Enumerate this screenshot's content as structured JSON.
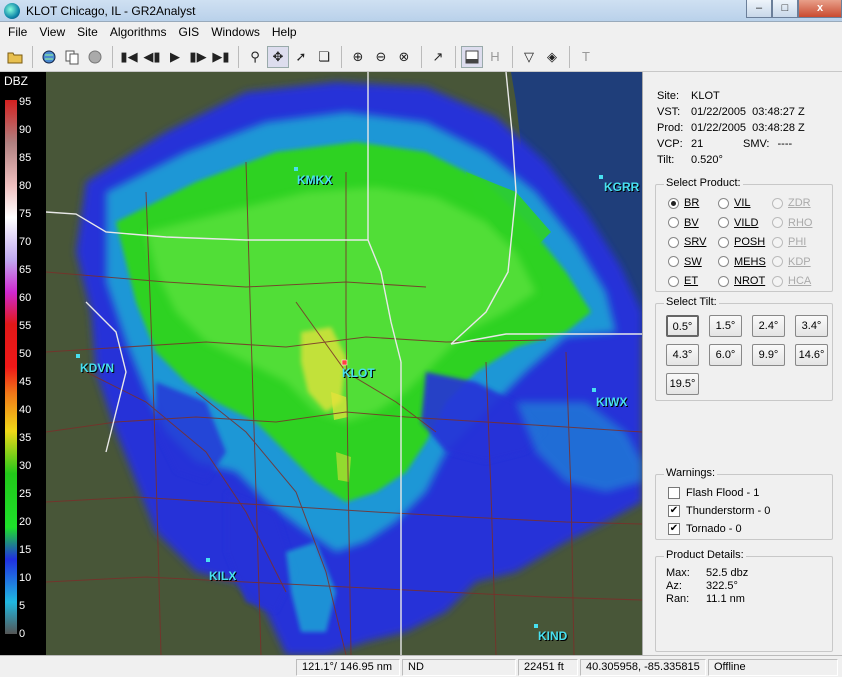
{
  "window": {
    "title": "KLOT Chicago, IL - GR2Analyst",
    "minimize_label": "–",
    "maximize_label": "□",
    "close_label": "x"
  },
  "menu": [
    "File",
    "View",
    "Site",
    "Algorithms",
    "GIS",
    "Windows",
    "Help"
  ],
  "scale": {
    "title": "DBZ",
    "labels": [
      "95",
      "90",
      "85",
      "80",
      "75",
      "70",
      "65",
      "60",
      "55",
      "50",
      "45",
      "40",
      "35",
      "30",
      "25",
      "20",
      "15",
      "10",
      "5",
      "0"
    ]
  },
  "map": {
    "sites": [
      {
        "id": "KMKX",
        "label": "KMKX"
      },
      {
        "id": "KGRR",
        "label": "KGRR"
      },
      {
        "id": "KDVN",
        "label": "KDVN"
      },
      {
        "id": "KLOT",
        "label": "KLOT"
      },
      {
        "id": "KIWX",
        "label": "KIWX"
      },
      {
        "id": "KILX",
        "label": "KILX"
      },
      {
        "id": "KIND",
        "label": "KIND"
      }
    ]
  },
  "site_info": {
    "site_label": "Site:",
    "site": "KLOT",
    "vst_label": "VST:",
    "vst": "01/22/2005  03:48:27 Z",
    "prod_label": "Prod:",
    "prod": "01/22/2005  03:48:28 Z",
    "vcp_label": "VCP:",
    "vcp": "21",
    "smv_label": "SMV:",
    "smv": "----",
    "tilt_label": "Tilt:",
    "tilt": "0.520°"
  },
  "select_product": {
    "title": "Select Product:",
    "col1": [
      {
        "label": "BR",
        "selected": true,
        "enabled": true
      },
      {
        "label": "BV",
        "selected": false,
        "enabled": true
      },
      {
        "label": "SRV",
        "selected": false,
        "enabled": true
      },
      {
        "label": "SW",
        "selected": false,
        "enabled": true
      },
      {
        "label": "ET",
        "selected": false,
        "enabled": true
      }
    ],
    "col2": [
      {
        "label": "VIL",
        "selected": false,
        "enabled": true
      },
      {
        "label": "VILD",
        "selected": false,
        "enabled": true
      },
      {
        "label": "POSH",
        "selected": false,
        "enabled": true
      },
      {
        "label": "MEHS",
        "selected": false,
        "enabled": true
      },
      {
        "label": "NROT",
        "selected": false,
        "enabled": true
      }
    ],
    "col3": [
      {
        "label": "ZDR",
        "selected": false,
        "enabled": false
      },
      {
        "label": "RHO",
        "selected": false,
        "enabled": false
      },
      {
        "label": "PHI",
        "selected": false,
        "enabled": false
      },
      {
        "label": "KDP",
        "selected": false,
        "enabled": false
      },
      {
        "label": "HCA",
        "selected": false,
        "enabled": false
      }
    ]
  },
  "select_tilt": {
    "title": "Select Tilt:",
    "tilts": [
      "0.5°",
      "1.5°",
      "2.4°",
      "3.4°",
      "4.3°",
      "6.0°",
      "9.9°",
      "14.6°",
      "19.5°"
    ],
    "active": 0
  },
  "warnings": {
    "title": "Warnings:",
    "items": [
      {
        "label": "Flash Flood - 1",
        "checked": false
      },
      {
        "label": "Thunderstorm - 0",
        "checked": true
      },
      {
        "label": "Tornado - 0",
        "checked": true
      }
    ]
  },
  "product_details": {
    "title": "Product Details:",
    "max_label": "Max:",
    "max": "52.5 dbz",
    "az_label": "Az:",
    "az": "322.5°",
    "ran_label": "Ran:",
    "ran": "11.1 nm"
  },
  "status": {
    "az_range": "121.1°/ 146.95 nm",
    "value": "ND",
    "height": "22451 ft",
    "latlon": "40.305958, -85.335815",
    "connection": "Offline"
  },
  "colors": {
    "echo_blue": "#2533d8",
    "echo_cyan": "#1ea9d6",
    "echo_green": "#2fd223",
    "echo_lightgreen": "#6ee84a",
    "echo_yellow": "#e8e23a",
    "terrain": "#4d5b3c",
    "site_label": "#48e0f0",
    "county_line": "#7a2f2a",
    "state_line": "#e8e8e8"
  }
}
